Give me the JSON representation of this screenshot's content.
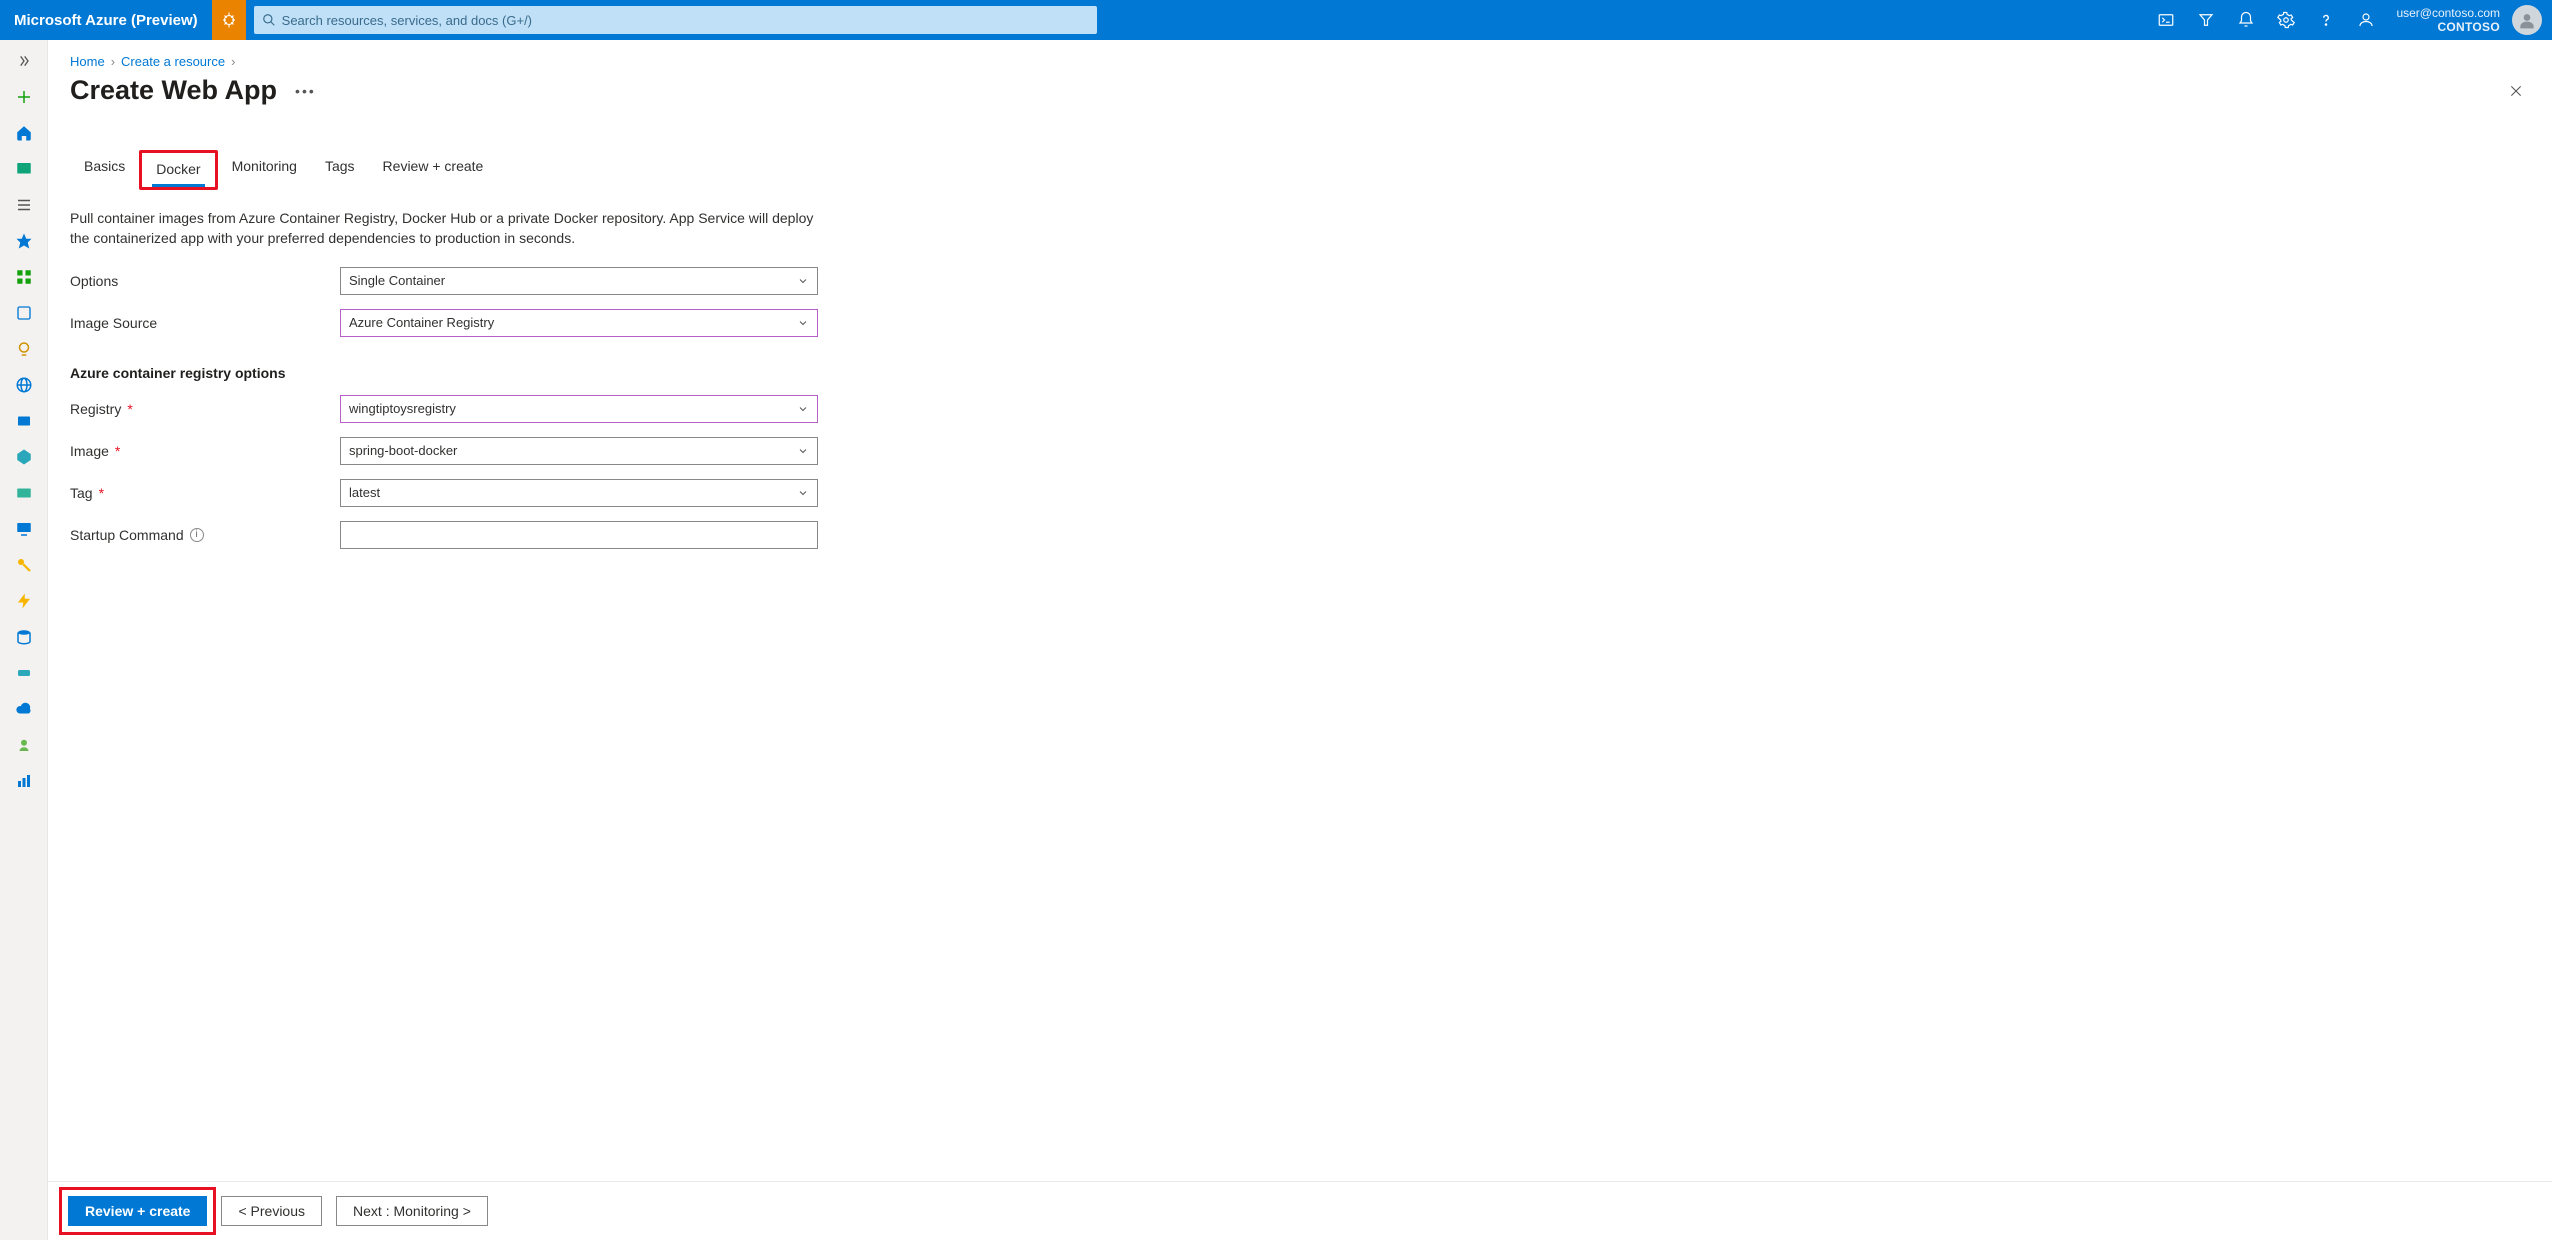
{
  "header": {
    "brand": "Microsoft Azure (Preview)",
    "search_placeholder": "Search resources, services, and docs (G+/)",
    "account_email": "user@contoso.com",
    "account_tenant": "CONTOSO"
  },
  "breadcrumb": {
    "items": [
      "Home",
      "Create a resource"
    ]
  },
  "page": {
    "title": "Create Web App"
  },
  "tabs": [
    "Basics",
    "Docker",
    "Monitoring",
    "Tags",
    "Review + create"
  ],
  "active_tab": "Docker",
  "highlighted_tab": "Docker",
  "description": "Pull container images from Azure Container Registry, Docker Hub or a private Docker repository. App Service will deploy the containerized app with your preferred dependencies to production in seconds.",
  "form": {
    "options_label": "Options",
    "options_value": "Single Container",
    "image_source_label": "Image Source",
    "image_source_value": "Azure Container Registry",
    "section_heading": "Azure container registry options",
    "registry_label": "Registry",
    "registry_value": "wingtiptoysregistry",
    "image_label": "Image",
    "image_value": "spring-boot-docker",
    "tag_label": "Tag",
    "tag_value": "latest",
    "startup_label": "Startup Command",
    "startup_value": ""
  },
  "footer": {
    "review_create": "Review + create",
    "previous": "<  Previous",
    "next": "Next : Monitoring  >"
  },
  "colors": {
    "azure_blue": "#0078d4",
    "highlight_red": "#e81123",
    "preview_orange": "#e98300",
    "select_purple": "#b65fc7"
  }
}
